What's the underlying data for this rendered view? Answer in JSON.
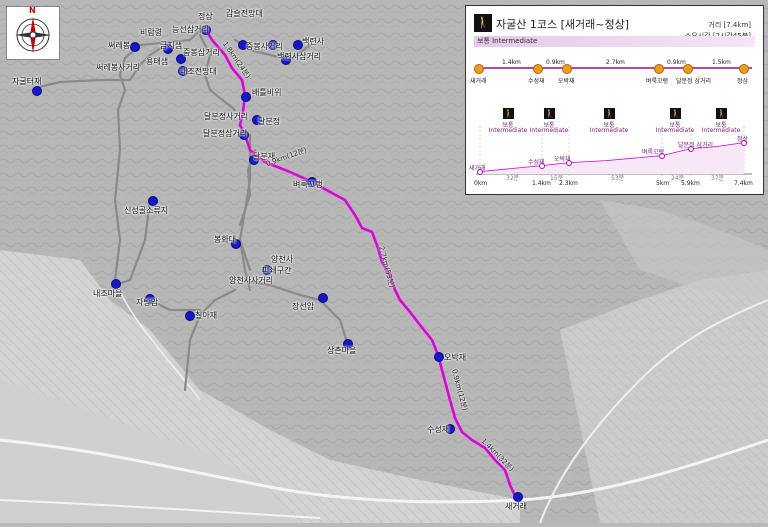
{
  "map": {
    "places": [
      {
        "name": "갑슬전망대"
      },
      {
        "name": "능선삼거리"
      },
      {
        "name": "비람령"
      },
      {
        "name": "써레봉"
      },
      {
        "name": "정상"
      },
      {
        "name": "금지샘"
      },
      {
        "name": "중봉삼거리"
      },
      {
        "name": "중봉사거리"
      },
      {
        "name": "백련사"
      },
      {
        "name": "백련사삼거리"
      },
      {
        "name": "써레봉사거리"
      },
      {
        "name": "용태샘"
      },
      {
        "name": "내조전망대"
      },
      {
        "name": "자굴터재"
      },
      {
        "name": "배틀비위"
      },
      {
        "name": "달분정사거리"
      },
      {
        "name": "달분정"
      },
      {
        "name": "달분정삼거리"
      },
      {
        "name": "달분재"
      },
      {
        "name": "벼룩꼬랭"
      },
      {
        "name": "봉화대"
      },
      {
        "name": "신성골소류지"
      },
      {
        "name": "양천사"
      },
      {
        "name": "피쇄구간"
      },
      {
        "name": "양천사사거리"
      },
      {
        "name": "내조마을"
      },
      {
        "name": "자방암"
      },
      {
        "name": "장선암"
      },
      {
        "name": "칠아재"
      },
      {
        "name": "상촌마을"
      },
      {
        "name": "오박재"
      },
      {
        "name": "수성재"
      },
      {
        "name": "새거래"
      }
    ],
    "trail_labels": [
      "1.8km(24분)",
      "0.9km(12분)",
      "2.7km(53분)",
      "0.9km(12분)",
      "1.4km(32분)"
    ]
  },
  "compass": {
    "north": "N"
  },
  "panel": {
    "title": "자굴산 1코스 [새거래~정상]",
    "distance": "거리 [7.4km]",
    "time": "소요시간 [2시간45분]",
    "difficulty": "보통 Intermediate",
    "hiker_icon": "hiker-icon",
    "segments": [
      "1.4km",
      "0.9km",
      "2.7km",
      "0.9km",
      "1.5km"
    ],
    "stops": [
      "새거래",
      "수성재",
      "오박재",
      "벼룩꼬랭",
      "달분정 삼거리",
      "정상"
    ],
    "profile_badges": [
      {
        "top": "보통",
        "bottom": "Intermediate"
      },
      {
        "top": "보통",
        "bottom": "Intermediate"
      },
      {
        "top": "보통",
        "bottom": "Intermediate"
      },
      {
        "top": "보통",
        "bottom": "Intermediate"
      },
      {
        "top": "보통",
        "bottom": "Intermediate"
      }
    ],
    "profile_points": [
      "새거래",
      "수성재",
      "오박재",
      "벼룩꼬랭",
      "달분정 삼거리",
      "정상"
    ],
    "axis": [
      "0km",
      "1.4km",
      "2.3km",
      "5km",
      "5.9km",
      "7.4km"
    ],
    "axis_mid": [
      "32분",
      "15분",
      "53분",
      "24분",
      "37분"
    ]
  }
}
